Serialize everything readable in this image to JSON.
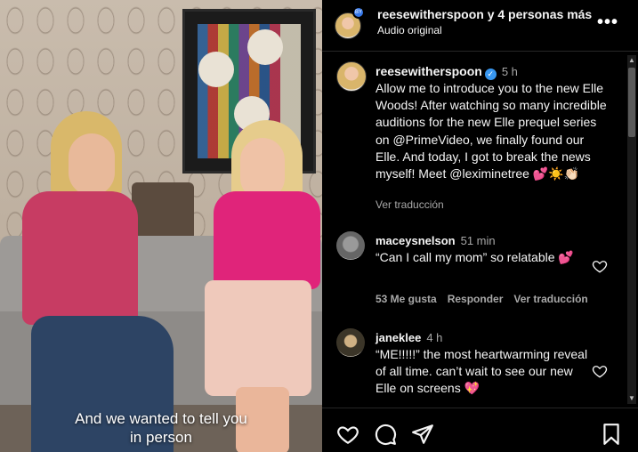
{
  "video": {
    "caption_line1": "And we wanted to tell you",
    "caption_line2": "in person"
  },
  "header": {
    "title": "reesewitherspoon y 4 personas más",
    "subtitle": "Audio original",
    "badge": "BY",
    "more_label": "•••"
  },
  "post": {
    "username": "reesewitherspoon",
    "verified_mark": "✓",
    "time": "5 h",
    "body": "Allow me to introduce you to the new Elle Woods! After watching so many incredible auditions for the new Elle prequel series on @PrimeVideo, we finally found our Elle. And today, I got to break the news myself! Meet @leximinetree 💕☀️👏🏻",
    "translate_label": "Ver traducción"
  },
  "comments": [
    {
      "username": "maceysnelson",
      "time": "51 min",
      "text": "“Can I call my mom” so relatable 💕",
      "likes": "53 Me gusta",
      "reply_label": "Responder",
      "translate_label": "Ver traducción"
    },
    {
      "username": "janeklee",
      "time": "4 h",
      "text": "“ME!!!!!” the most heartwarming reveal of all time. can’t wait to see our new Elle on screens 💖"
    }
  ],
  "actions": {
    "like_icon": "heart-icon",
    "comment_icon": "comment-icon",
    "share_icon": "send-icon",
    "save_icon": "bookmark-icon"
  },
  "scroll": {
    "up": "▲",
    "down": "▼"
  }
}
